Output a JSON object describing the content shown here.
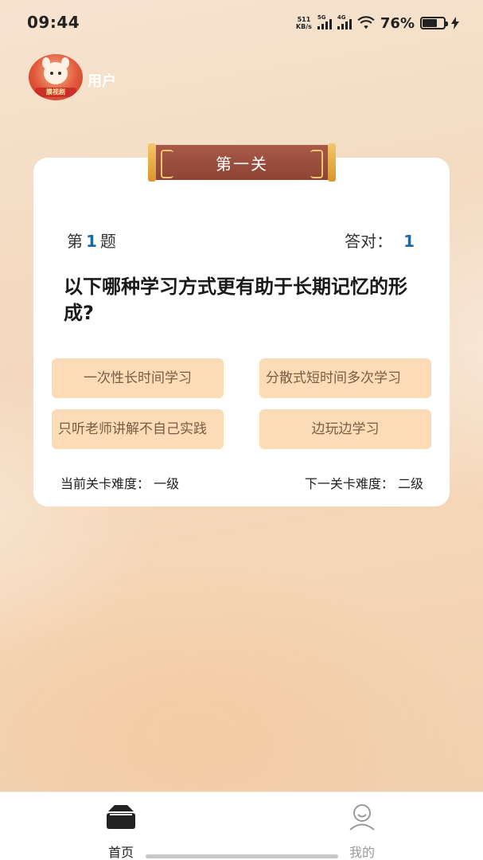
{
  "status_bar": {
    "time": "09:44",
    "net_speed_value": "511",
    "net_speed_unit": "KB/s",
    "sim1_tag": "5G",
    "sim2_tag": "4G",
    "battery_percent": "76%"
  },
  "header": {
    "avatar_banner": "膜视剧",
    "username": "用户"
  },
  "level": {
    "title": "第一关"
  },
  "quiz": {
    "index_prefix": "第",
    "index_number": "1",
    "index_suffix": "题",
    "correct_label": "答对：",
    "correct_count": "1",
    "question": "以下哪种学习方式更有助于长期记忆的形成?",
    "options": [
      {
        "label": "一次性长时间学习"
      },
      {
        "label": "分散式短时间多次学习"
      },
      {
        "label": "只听老师讲解不自己实践"
      },
      {
        "label": "边玩边学习"
      }
    ],
    "current_difficulty": "当前关卡难度：  一级",
    "next_difficulty": "下一关卡难度：  二级"
  },
  "bottom_nav": {
    "items": [
      {
        "label": "首页",
        "icon": "home-icon",
        "active": true
      },
      {
        "label": "我的",
        "icon": "user-icon",
        "active": false
      }
    ]
  },
  "colors": {
    "accent_blue": "#1b6aa5",
    "option_bg": "#fbdcb6",
    "ribbon": "#8c4434"
  }
}
